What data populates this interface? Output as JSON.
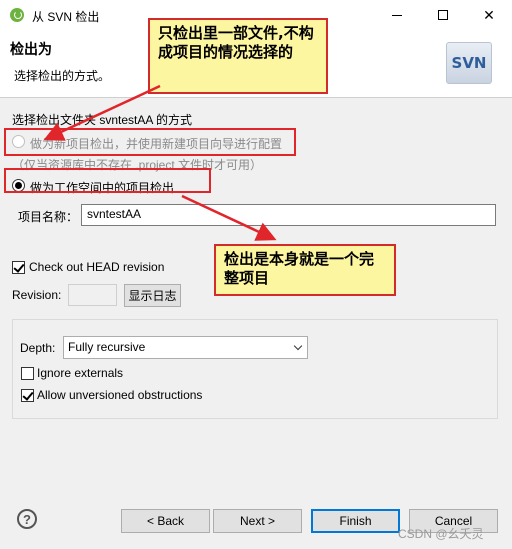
{
  "window": {
    "title": "从 SVN 检出"
  },
  "header": {
    "title": "检出为",
    "description": "选择检出的方式。",
    "logo_text": "SVN"
  },
  "checkout": {
    "section_label": "选择检出文件夹 svntestAA 的方式",
    "option_new_project": "做为新项目检出，并使用新建项目向导进行配置",
    "option_new_project_hint": "（仅当资源库中不存在 .project 文件时才可用）",
    "option_workspace": "做为工作空间中的项目检出",
    "selected_option": "option_workspace",
    "project_name_label": "项目名称：",
    "project_name_value": "svntestAA",
    "head_revision_label": "Check out HEAD revision",
    "head_revision_checked": true,
    "revision_label": "Revision:",
    "revision_value": "",
    "show_log_button": "显示日志"
  },
  "depth_group": {
    "depth_label": "Depth:",
    "depth_value": "Fully recursive",
    "ignore_externals_label": "Ignore externals",
    "ignore_externals_checked": false,
    "allow_unversioned_label": "Allow unversioned obstructions",
    "allow_unversioned_checked": true
  },
  "footer": {
    "back_button": "< Back",
    "next_button": "Next >",
    "finish_button": "Finish",
    "cancel_button": "Cancel"
  },
  "annotations": {
    "note_top": "只检出里一部文件,不构成项目的情况选择的",
    "note_middle": "检出是本身就是一个完整项目"
  },
  "watermark": "CSDN @幺夭灵",
  "colors": {
    "annotation_border": "#d12b2b",
    "annotation_fill": "#fdf6a0",
    "focus_accent": "#0078d7"
  }
}
